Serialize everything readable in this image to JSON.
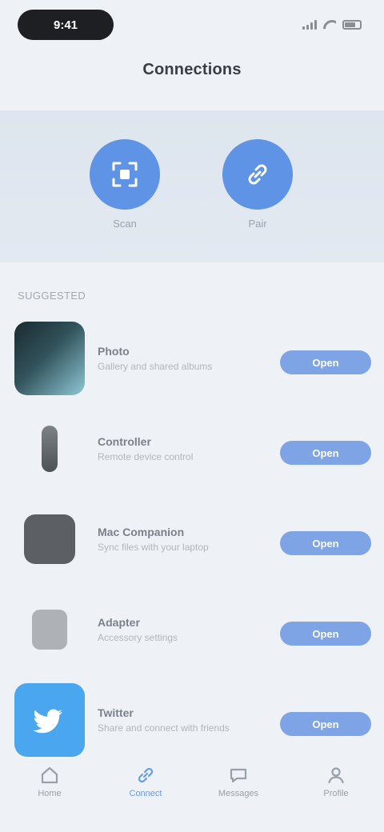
{
  "status_bar": {
    "time": "9:41"
  },
  "page_title": "Connections",
  "hero": {
    "actions": [
      {
        "label": "Scan",
        "icon": "qr-scan-icon"
      },
      {
        "label": "Pair",
        "icon": "link-icon"
      }
    ]
  },
  "section_header": "Suggested",
  "apps": [
    {
      "name": "Photo",
      "subtitle": "Gallery and shared albums",
      "button": "Open",
      "icon": "photo-app-icon"
    },
    {
      "name": "Controller",
      "subtitle": "Remote device control",
      "button": "Open",
      "icon": "device-icon"
    },
    {
      "name": "Mac Companion",
      "subtitle": "Sync files with your laptop",
      "button": "Open",
      "icon": "laptop-icon"
    },
    {
      "name": "Adapter",
      "subtitle": "Accessory settings",
      "button": "Open",
      "icon": "adapter-icon"
    },
    {
      "name": "Twitter",
      "subtitle": "Share and connect with friends",
      "button": "Open",
      "icon": "bird-icon"
    }
  ],
  "tabs": [
    {
      "label": "Home",
      "icon": "home-icon",
      "active": false
    },
    {
      "label": "Connect",
      "icon": "connect-icon",
      "active": true
    },
    {
      "label": "Messages",
      "icon": "chat-icon",
      "active": false
    },
    {
      "label": "Profile",
      "icon": "person-icon",
      "active": false
    }
  ],
  "colors": {
    "accent": "#5f93e6",
    "button": "#7ea4e6",
    "background": "#eef2f6",
    "hero_background": "#dde5ee"
  }
}
